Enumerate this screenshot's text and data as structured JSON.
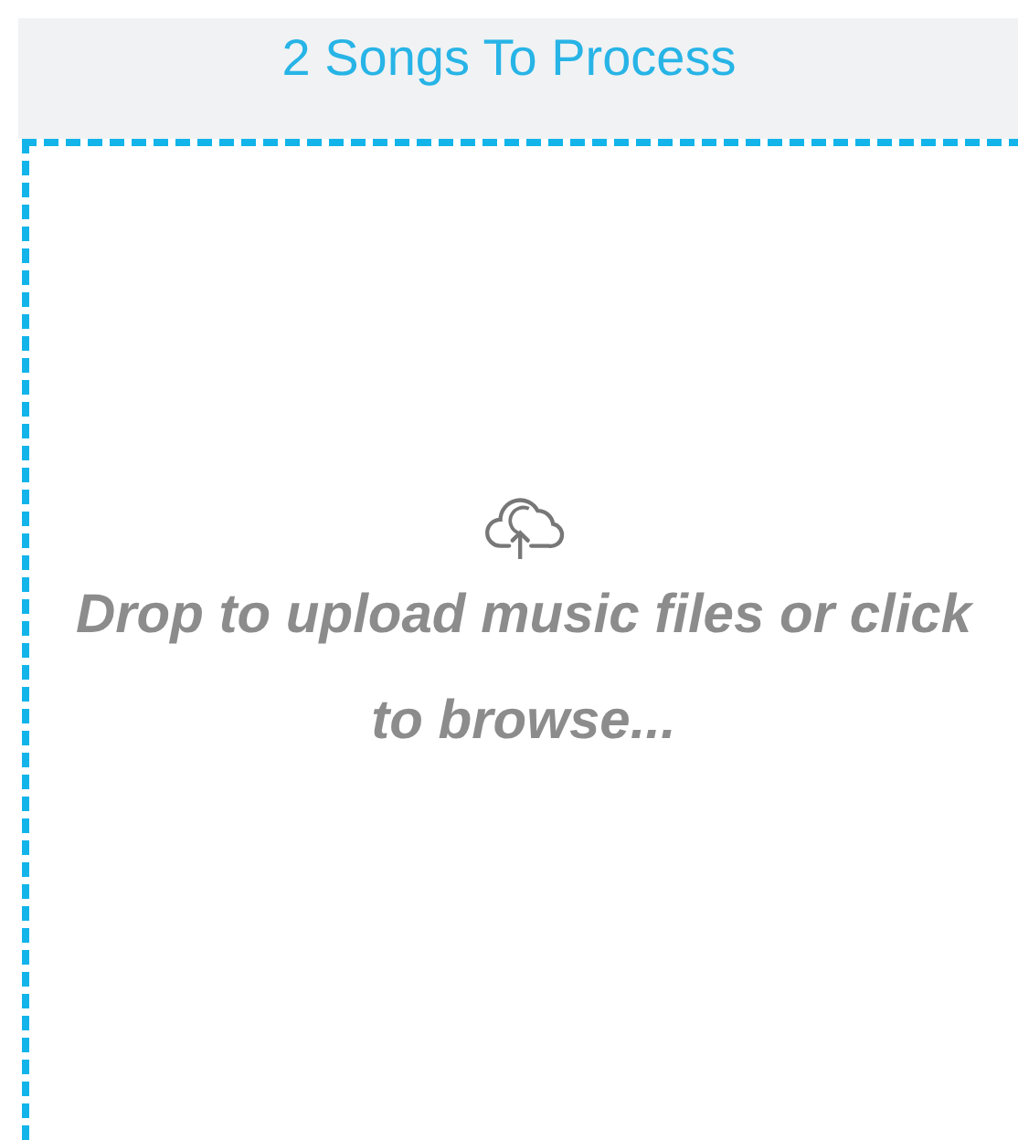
{
  "header": {
    "title": "2 Songs To Process"
  },
  "dropzone": {
    "message": "Drop to upload music files or click to browse..."
  }
}
